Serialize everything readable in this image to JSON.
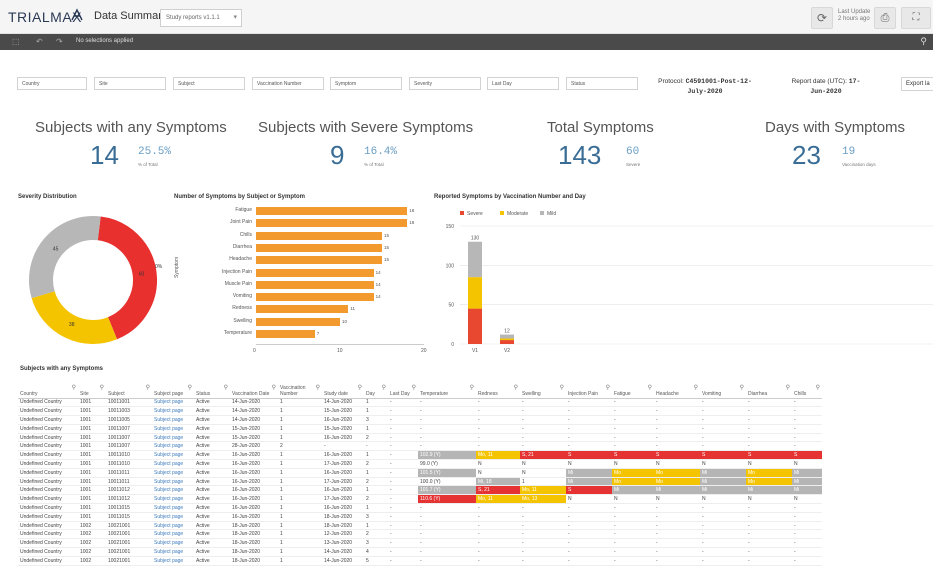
{
  "header": {
    "logo": "TRIALMAX",
    "title": "Data Summary",
    "sheet": "Study reports v1.1.1",
    "last_update_line1": "Last Update",
    "last_update_line2": "2 hours ago"
  },
  "selection_bar": {
    "message": "No selections applied"
  },
  "filters": [
    "Country",
    "Site",
    "Subject",
    "Vaccination Number",
    "Symptom",
    "Severity",
    "Last Day",
    "Status"
  ],
  "protocol": {
    "label": "Protocol: ",
    "value": "C4591001-Post-12-",
    "value2": "July-2020"
  },
  "report_date": {
    "label": "Report date (UTC): ",
    "value": "17-",
    "value2": "Jun-2020"
  },
  "export_label": "Export la",
  "kpis": [
    {
      "title": "Subjects with any Symptoms",
      "value": "14",
      "secondary": "25.5%",
      "sub": "% of Total"
    },
    {
      "title": "Subjects with Severe Symptoms",
      "value": "9",
      "secondary": "16.4%",
      "sub": "% of Total"
    },
    {
      "title": "Total Symptoms",
      "value": "143",
      "secondary": "60",
      "sub": "Severe"
    },
    {
      "title": "Days with Symptoms",
      "value": "23",
      "secondary": "19",
      "sub": "Vaccination days"
    }
  ],
  "panels": {
    "severity": "Severity Distribution",
    "symptoms": "Number of Symptoms by Subject or Symptom",
    "reported": "Reported Symptoms by Vaccination Number and Day",
    "table": "Subjects with any Symptoms"
  },
  "chart_data": [
    {
      "type": "pie",
      "title": "Severity Distribution",
      "labels": [
        "Severe",
        "Moderate",
        "Mild"
      ],
      "values": [
        60,
        38,
        45
      ],
      "colors": [
        "#e8302f",
        "#f5c400",
        "#b7b7b7"
      ],
      "slice_labels": [
        "60",
        "38",
        "45",
        "0%"
      ]
    },
    {
      "type": "bar",
      "title": "Number of Symptoms by Subject or Symptom",
      "ylabel": "Symptom",
      "categories": [
        "Fatigue",
        "Joint Pain",
        "Chills",
        "Diarrhea",
        "Headache",
        "Injection Pain",
        "Muscle Pain",
        "Vomiting",
        "Redness",
        "Swelling",
        "Temperature"
      ],
      "values": [
        18,
        18,
        15,
        15,
        15,
        14,
        14,
        14,
        11,
        10,
        7
      ],
      "xlim": [
        0,
        20
      ],
      "xticks": [
        "0",
        "10",
        "20"
      ],
      "color": "#f29a2e"
    },
    {
      "type": "bar",
      "title": "Reported Symptoms by Vaccination Number and Day",
      "categories": [
        "V1",
        "V2"
      ],
      "series": [
        {
          "name": "Severe",
          "values": [
            45,
            5
          ],
          "color": "#e8482f"
        },
        {
          "name": "Moderate",
          "values": [
            40,
            2
          ],
          "color": "#f5c400"
        },
        {
          "name": "Mild",
          "values": [
            45,
            5
          ],
          "color": "#b7b7b7"
        }
      ],
      "totals": [
        "130",
        "12"
      ],
      "yticks": [
        "0",
        "50",
        "100",
        "150"
      ],
      "ylim": [
        0,
        150
      ]
    }
  ],
  "table": {
    "columns": [
      "Country",
      "Site",
      "Subject",
      "Subject page",
      "Status",
      "Vaccination Date",
      "Vaccination Number",
      "Study date",
      "Day",
      "Last Day",
      "Temperature",
      "Redness",
      "Swelling",
      "Injection Pain",
      "Fatigue",
      "Headache",
      "Vomiting",
      "Diarrhea",
      "Chills"
    ],
    "rows": [
      [
        "Undefined Country",
        "1001",
        "10011001",
        "Subject page",
        "Active",
        "14-Jun-2020",
        "1",
        "14-Jun-2020",
        "1",
        "-",
        "-",
        "-",
        "-",
        "-",
        "-",
        "-",
        "-",
        "-",
        "-"
      ],
      [
        "Undefined Country",
        "1001",
        "10011003",
        "Subject page",
        "Active",
        "14-Jun-2020",
        "1",
        "15-Jun-2020",
        "1",
        "-",
        "-",
        "-",
        "-",
        "-",
        "-",
        "-",
        "-",
        "-",
        "-"
      ],
      [
        "Undefined Country",
        "1001",
        "10011005",
        "Subject page",
        "Active",
        "14-Jun-2020",
        "1",
        "16-Jun-2020",
        "3",
        "-",
        "-",
        "-",
        "-",
        "-",
        "-",
        "-",
        "-",
        "-",
        "-"
      ],
      [
        "Undefined Country",
        "1001",
        "10011007",
        "Subject page",
        "Active",
        "15-Jun-2020",
        "1",
        "15-Jun-2020",
        "1",
        "-",
        "-",
        "-",
        "-",
        "-",
        "-",
        "-",
        "-",
        "-",
        "-"
      ],
      [
        "Undefined Country",
        "1001",
        "10011007",
        "Subject page",
        "Active",
        "15-Jun-2020",
        "1",
        "16-Jun-2020",
        "2",
        "-",
        "-",
        "-",
        "-",
        "-",
        "-",
        "-",
        "-",
        "-",
        "-"
      ],
      [
        "Undefined Country",
        "1001",
        "10011007",
        "Subject page",
        "Active",
        "28-Jun-2020",
        "2",
        "-",
        "-",
        "-",
        "-",
        "-",
        "-",
        "-",
        "-",
        "-",
        "-",
        "-",
        "-"
      ],
      [
        "Undefined Country",
        "1001",
        "10011010",
        "Subject page",
        "Active",
        "16-Jun-2020",
        "1",
        "16-Jun-2020",
        "1",
        "-",
        "102.9 (Y)",
        "Mo, 11",
        "S, 21",
        "S",
        "S",
        "S",
        "S",
        "S",
        "S"
      ],
      [
        "Undefined Country",
        "1001",
        "10011010",
        "Subject page",
        "Active",
        "16-Jun-2020",
        "1",
        "17-Jun-2020",
        "2",
        "-",
        "99.0 (Y)",
        "N",
        "N",
        "N",
        "N",
        "N",
        "N",
        "N",
        "N"
      ],
      [
        "Undefined Country",
        "1001",
        "10011011",
        "Subject page",
        "Active",
        "16-Jun-2020",
        "1",
        "16-Jun-2020",
        "1",
        "-",
        "101.5 (Y)",
        "N",
        "N",
        "Mi",
        "Mo",
        "Mo",
        "Mi",
        "Mo",
        "Mi"
      ],
      [
        "Undefined Country",
        "1001",
        "10011011",
        "Subject page",
        "Active",
        "16-Jun-2020",
        "1",
        "17-Jun-2020",
        "2",
        "-",
        "100.0 (Y)",
        "Mi, 18",
        "1",
        "Mi",
        "Mo",
        "Mo",
        "Mi",
        "Mo",
        "Mi"
      ],
      [
        "Undefined Country",
        "1001",
        "10011012",
        "Subject page",
        "Active",
        "16-Jun-2020",
        "1",
        "16-Jun-2020",
        "1",
        "-",
        "101.7 (Y)",
        "S, 21",
        "Mo, 11",
        "S",
        "Mi",
        "Mi",
        "Mi",
        "Mi",
        "Mi"
      ],
      [
        "Undefined Country",
        "1001",
        "10011012",
        "Subject page",
        "Active",
        "16-Jun-2020",
        "1",
        "17-Jun-2020",
        "2",
        "-",
        "110.6 (Y)",
        "Mo, 11",
        "Mo, 13",
        "N",
        "N",
        "N",
        "N",
        "N",
        "N"
      ],
      [
        "Undefined Country",
        "1001",
        "10011015",
        "Subject page",
        "Active",
        "16-Jun-2020",
        "1",
        "16-Jun-2020",
        "1",
        "-",
        "-",
        "-",
        "-",
        "-",
        "-",
        "-",
        "-",
        "-",
        "-"
      ],
      [
        "Undefined Country",
        "1001",
        "10011015",
        "Subject page",
        "Active",
        "16-Jun-2020",
        "1",
        "18-Jun-2020",
        "3",
        "-",
        "-",
        "-",
        "-",
        "-",
        "-",
        "-",
        "-",
        "-",
        "-"
      ],
      [
        "Undefined Country",
        "1002",
        "10021001",
        "Subject page",
        "Active",
        "18-Jun-2020",
        "1",
        "18-Jun-2020",
        "1",
        "-",
        "-",
        "-",
        "-",
        "-",
        "-",
        "-",
        "-",
        "-",
        "-"
      ],
      [
        "Undefined Country",
        "1002",
        "10021001",
        "Subject page",
        "Active",
        "18-Jun-2020",
        "1",
        "12-Jun-2020",
        "2",
        "-",
        "-",
        "-",
        "-",
        "-",
        "-",
        "-",
        "-",
        "-",
        "-"
      ],
      [
        "Undefined Country",
        "1002",
        "10021001",
        "Subject page",
        "Active",
        "18-Jun-2020",
        "1",
        "13-Jun-2020",
        "3",
        "-",
        "-",
        "-",
        "-",
        "-",
        "-",
        "-",
        "-",
        "-",
        "-"
      ],
      [
        "Undefined Country",
        "1002",
        "10021001",
        "Subject page",
        "Active",
        "18-Jun-2020",
        "1",
        "14-Jun-2020",
        "4",
        "-",
        "-",
        "-",
        "-",
        "-",
        "-",
        "-",
        "-",
        "-",
        "-"
      ],
      [
        "Undefined Country",
        "1002",
        "10021001",
        "Subject page",
        "Active",
        "18-Jun-2020",
        "1",
        "14-Jun-2020",
        "5",
        "-",
        "-",
        "-",
        "-",
        "-",
        "-",
        "-",
        "-",
        "-",
        "-"
      ]
    ],
    "cell_colors": {
      "6": {
        "10": "grey",
        "11": "yel",
        "12": "red",
        "13": "red",
        "14": "red",
        "15": "red",
        "16": "red",
        "17": "red",
        "18": "red"
      },
      "8": {
        "10": "grey",
        "13": "grey",
        "14": "yel",
        "15": "yel",
        "16": "grey",
        "17": "yel",
        "18": "grey"
      },
      "9": {
        "11": "grey",
        "13": "grey",
        "14": "yel",
        "15": "yel",
        "16": "grey",
        "17": "yel",
        "18": "grey"
      },
      "10": {
        "10": "grey",
        "11": "red",
        "12": "yel",
        "13": "red",
        "14": "grey",
        "15": "grey",
        "16": "grey",
        "17": "grey",
        "18": "grey"
      },
      "11": {
        "10": "red",
        "11": "yel",
        "12": "yel"
      }
    }
  }
}
